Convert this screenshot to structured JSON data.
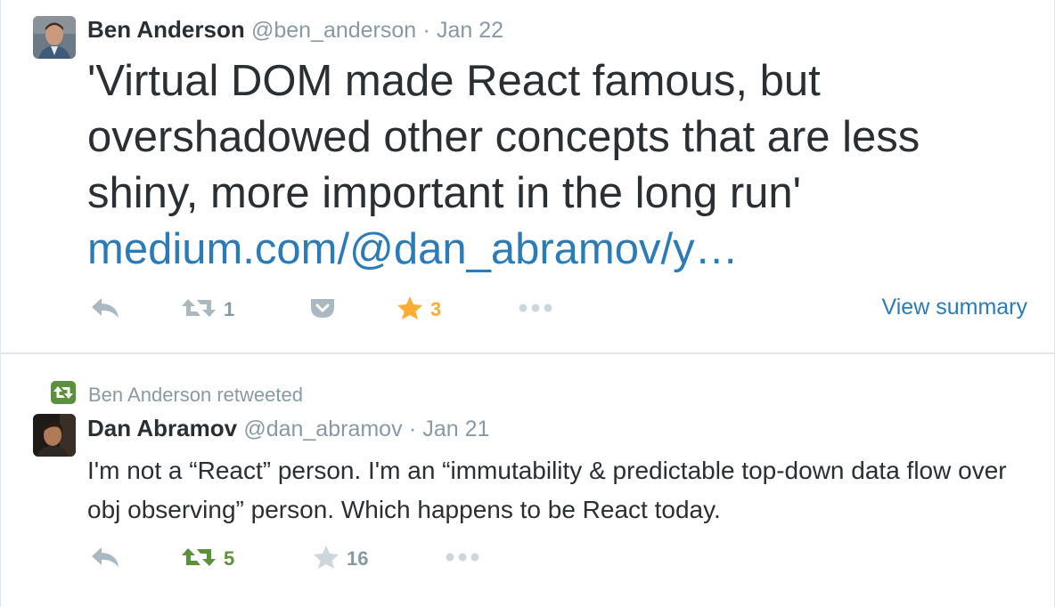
{
  "colors": {
    "text": "#292f33",
    "muted": "#8899a6",
    "link": "#2b7bb9",
    "retweet_active": "#5c913b",
    "favorite_active": "#ffac33",
    "border": "#e1e8ed"
  },
  "tweets": [
    {
      "fullname": "Ben Anderson",
      "username": "@ben_anderson",
      "separator": "·",
      "date": "Jan 22",
      "text": "'Virtual DOM made React famous, but overshadowed other concepts that are less shiny, more important in the long run'",
      "link": "medium.com/@dan_abramov/y…",
      "actions": {
        "reply_icon": "reply-icon",
        "retweet_icon": "retweet-icon",
        "retweet_count": "1",
        "pocket_icon": "pocket-icon",
        "favorite_icon": "star-icon",
        "favorite_count": "3",
        "favorited": true,
        "more_icon": "more-icon",
        "view_summary": "View summary"
      }
    },
    {
      "context": "Ben Anderson retweeted",
      "fullname": "Dan Abramov",
      "username": "@dan_abramov",
      "separator": "·",
      "date": "Jan 21",
      "text": "I'm not a “React” person. I'm an “immutability & predictable top-down data flow over obj observing” person. Which happens to be React today.",
      "actions": {
        "reply_icon": "reply-icon",
        "retweet_icon": "retweet-icon",
        "retweet_count": "5",
        "retweeted": true,
        "favorite_icon": "star-icon",
        "favorite_count": "16",
        "more_icon": "more-icon"
      }
    }
  ]
}
